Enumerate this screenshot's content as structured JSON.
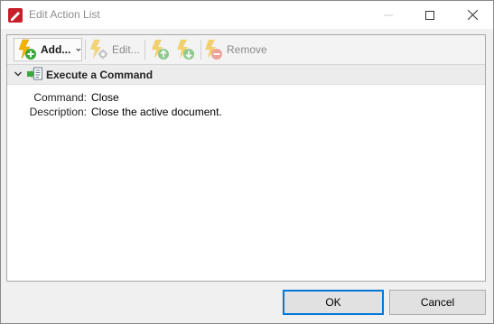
{
  "window": {
    "title": "Edit Action List"
  },
  "toolbar": {
    "add_label": "Add...",
    "edit_label": "Edit...",
    "remove_label": "Remove"
  },
  "group": {
    "label": "Execute a Command"
  },
  "properties": [
    {
      "key": "Command:",
      "value": "Close"
    },
    {
      "key": "Description:",
      "value": "Close the active document."
    }
  ],
  "footer": {
    "ok_label": "OK",
    "cancel_label": "Cancel"
  },
  "colors": {
    "accent": "#0078d7",
    "app_icon": "#c8202b",
    "bolt": "#f2b400",
    "add_green": "#3aa83a",
    "remove_red": "#e8614e"
  }
}
